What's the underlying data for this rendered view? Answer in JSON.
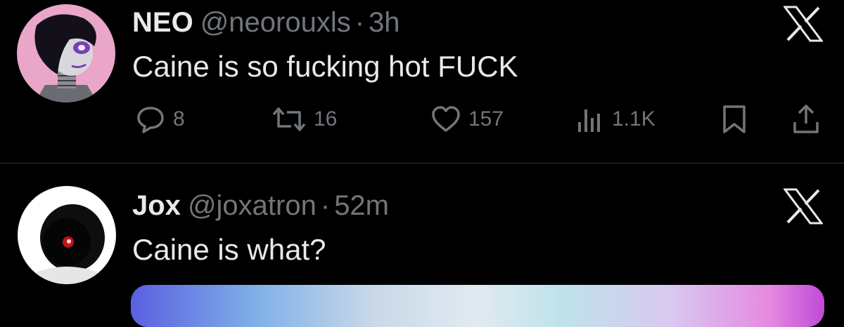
{
  "posts": [
    {
      "display_name": "NEO",
      "handle": "@neorouxls",
      "separator": "·",
      "time": "3h",
      "text": "Caine is so fucking hot FUCK",
      "actions": {
        "replies": "8",
        "reposts": "16",
        "likes": "157",
        "views": "1.1K"
      }
    },
    {
      "display_name": "Jox",
      "handle": "@joxatron",
      "separator": "·",
      "time": "52m",
      "text": "Caine is what?"
    }
  ],
  "icons": {
    "reply": "speech-bubble-icon",
    "repost": "repost-arrows-icon",
    "like": "heart-icon",
    "views": "bar-chart-icon",
    "bookmark": "bookmark-icon",
    "share": "share-upload-icon",
    "logo": "x-logo-icon"
  },
  "colors": {
    "background": "#000000",
    "text_primary": "#e7e9ea",
    "text_secondary": "#71767b",
    "divider": "#2f3336"
  }
}
